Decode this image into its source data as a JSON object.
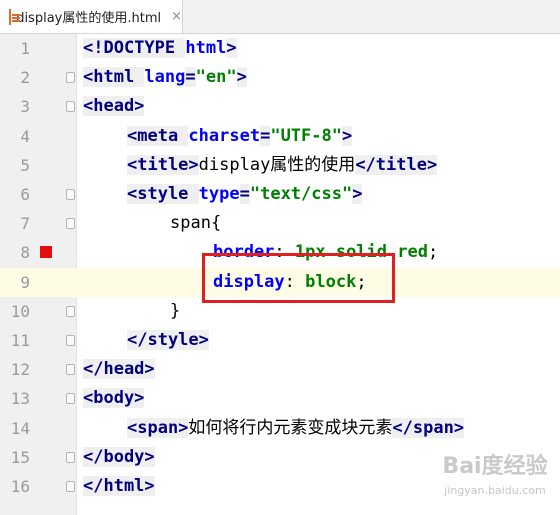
{
  "tab": {
    "title": "display属性的使用.html",
    "close_glyph": "×",
    "icon": "html-file-icon"
  },
  "lines": [
    {
      "n": "1",
      "tokens": [
        [
          "tag",
          "<!DOCTYPE "
        ],
        [
          "attr",
          "html"
        ],
        [
          "tag",
          ">"
        ]
      ]
    },
    {
      "n": "2",
      "tokens": [
        [
          "tag",
          "<html "
        ],
        [
          "attr",
          "lang"
        ],
        [
          "tag",
          "="
        ],
        [
          "str",
          "\"en\""
        ],
        [
          "tag",
          ">"
        ]
      ]
    },
    {
      "n": "3",
      "tokens": [
        [
          "tag",
          "<head>"
        ]
      ]
    },
    {
      "n": "4",
      "tokens": [
        [
          "tag",
          "<meta "
        ],
        [
          "attr",
          "charset"
        ],
        [
          "tag",
          "="
        ],
        [
          "str",
          "\"UTF-8\""
        ],
        [
          "tag",
          ">"
        ]
      ]
    },
    {
      "n": "5",
      "tokens": [
        [
          "tag",
          "<title>"
        ],
        [
          "plain",
          "display属性的使用"
        ],
        [
          "tag",
          "</title>"
        ]
      ]
    },
    {
      "n": "6",
      "tokens": [
        [
          "tag",
          "<style "
        ],
        [
          "attr",
          "type"
        ],
        [
          "tag",
          "="
        ],
        [
          "str",
          "\"text/css\""
        ],
        [
          "tag",
          ">"
        ]
      ]
    },
    {
      "n": "7",
      "tokens": [
        [
          "plain",
          "span{"
        ]
      ]
    },
    {
      "n": "8",
      "tokens": [
        [
          "css-prop",
          "border"
        ],
        [
          "plain",
          ": "
        ],
        [
          "css-val",
          "1px solid red"
        ],
        [
          "plain",
          ";"
        ]
      ]
    },
    {
      "n": "9",
      "tokens": [
        [
          "css-prop",
          "display"
        ],
        [
          "plain",
          ": "
        ],
        [
          "css-val",
          "block"
        ],
        [
          "plain",
          ";"
        ]
      ]
    },
    {
      "n": "10",
      "tokens": [
        [
          "plain",
          "}"
        ]
      ]
    },
    {
      "n": "11",
      "tokens": [
        [
          "tag",
          "</style>"
        ]
      ]
    },
    {
      "n": "12",
      "tokens": [
        [
          "tag",
          "</head>"
        ]
      ]
    },
    {
      "n": "13",
      "tokens": [
        [
          "tag",
          "<body>"
        ]
      ]
    },
    {
      "n": "14",
      "tokens": [
        [
          "tag",
          "<span>"
        ],
        [
          "plain",
          "如何将行内元素变成块元素"
        ],
        [
          "tag",
          "</span>"
        ]
      ]
    },
    {
      "n": "15",
      "tokens": [
        [
          "tag",
          "</body>"
        ]
      ]
    },
    {
      "n": "16",
      "tokens": [
        [
          "tag",
          "</html>"
        ]
      ]
    }
  ],
  "watermark": {
    "brand": "Bai度经验",
    "url": "jingyan.baidu.com"
  }
}
